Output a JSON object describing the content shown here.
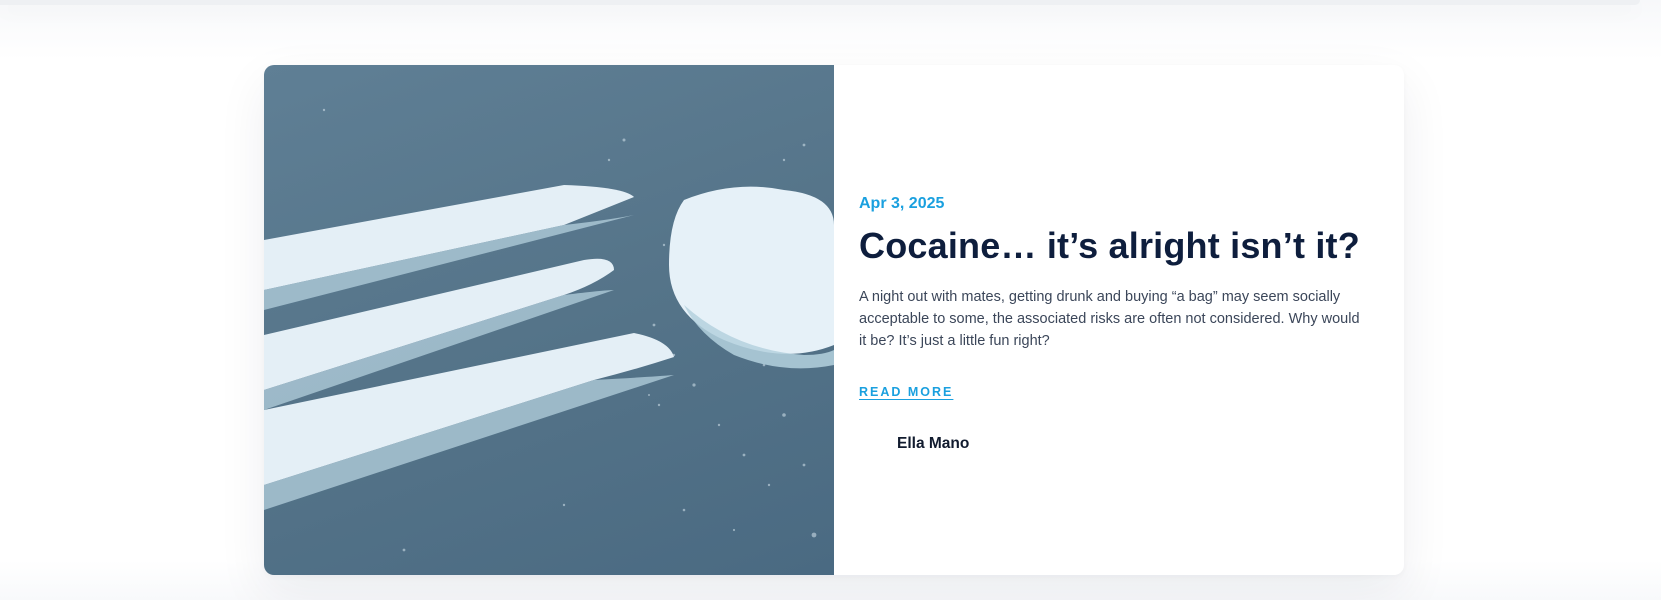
{
  "post": {
    "date": "Apr 3, 2025",
    "title": "Cocaine… it’s alright isn’t it?",
    "excerpt": "A night out with mates, getting drunk and buying “a bag” may seem socially acceptable to some, the associated risks are often not considered. Why would it be? It’s just a little fun right?",
    "read_more_label": "READ MORE",
    "author": {
      "name": "Ella Mano"
    },
    "image": {
      "icon": "featured-image-white-powder-lines"
    }
  },
  "colors": {
    "accent": "#1aa0df",
    "title": "#0e1e3d",
    "body_text": "#3b4659",
    "image_tint": "#557489"
  }
}
